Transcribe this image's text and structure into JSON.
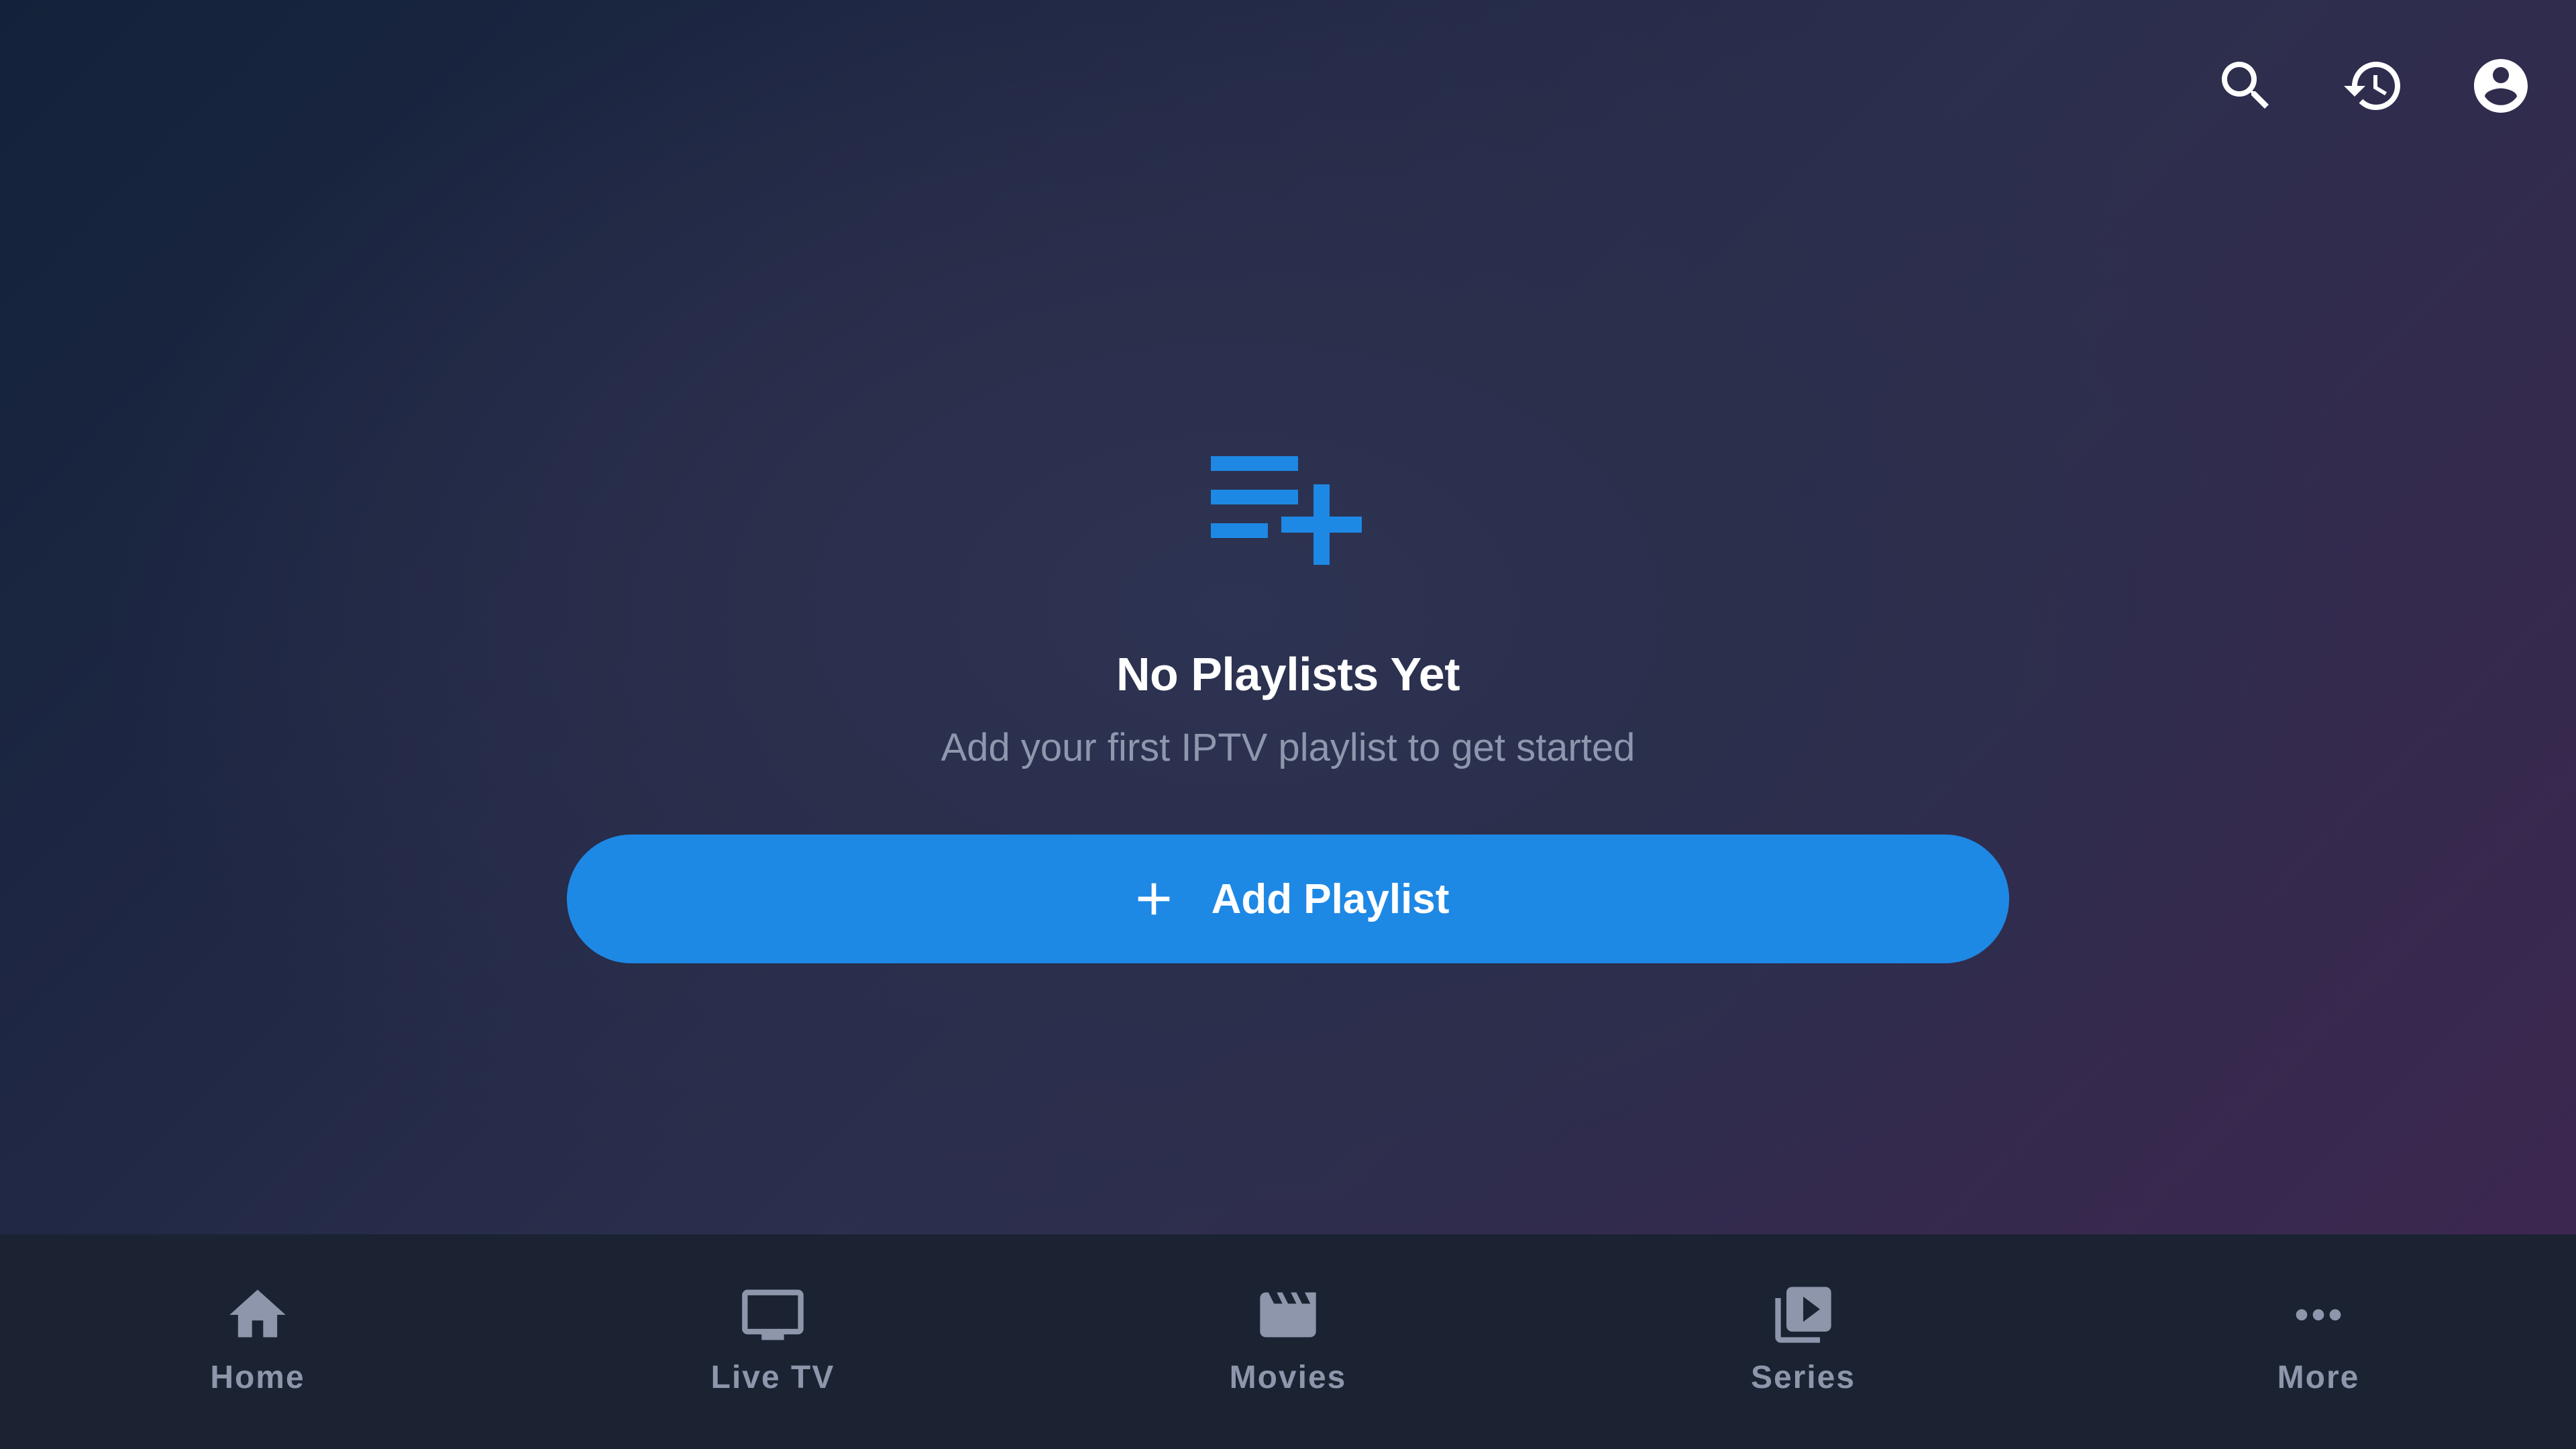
{
  "topbar": {
    "icons": [
      "search-icon",
      "history-icon",
      "account-circle-icon"
    ]
  },
  "empty_state": {
    "icon": "playlist-add-icon",
    "title": "No Playlists Yet",
    "subtitle": "Add your first IPTV playlist to get started",
    "button_icon": "plus-icon",
    "button_label": "Add Playlist"
  },
  "bottom_nav": {
    "items": [
      {
        "label": "Home",
        "icon": "home-icon"
      },
      {
        "label": "Live TV",
        "icon": "tv-icon"
      },
      {
        "label": "Movies",
        "icon": "movie-clapper-icon"
      },
      {
        "label": "Series",
        "icon": "video-library-icon"
      },
      {
        "label": "More",
        "icon": "more-horizontal-icon"
      }
    ]
  },
  "colors": {
    "accent": "#1e88e5",
    "nav_background": "#1b2333",
    "nav_text": "#8d96ab",
    "subtitle_text": "#8e97ad"
  }
}
